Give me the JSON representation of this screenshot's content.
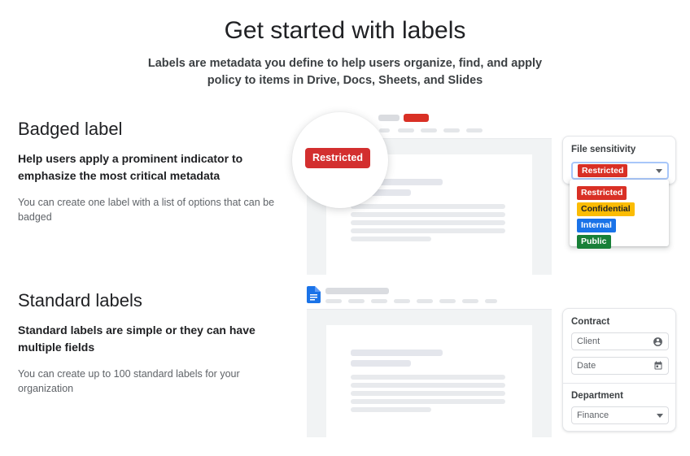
{
  "header": {
    "title": "Get started with labels",
    "subtitle": "Labels are metadata you define to help users organize, find, and apply policy to items in Drive, Docs, Sheets, and Slides"
  },
  "sections": [
    {
      "id": "badged",
      "title": "Badged label",
      "lead": "Help users apply a prominent indicator to emphasize the most critical metadata",
      "body": "You can create one label with a list of options that can be badged"
    },
    {
      "id": "standard",
      "title": "Standard labels",
      "lead": "Standard labels are simple or they can have multiple fields",
      "body": "You can create up to 100 standard labels for your organization"
    }
  ],
  "magnifier": {
    "badge_label": "Restricted",
    "badge_color": "#d32f2f"
  },
  "file_sensitivity_card": {
    "label": "File sensitivity",
    "selected_value": "Restricted",
    "selected_color": "#d93025",
    "caret_icon": "chevron-down-icon",
    "options": [
      {
        "label": "Restricted",
        "color": "#d93025",
        "text_color": "#ffffff"
      },
      {
        "label": "Confidential",
        "color": "#fbbc04",
        "text_color": "#202124"
      },
      {
        "label": "Internal",
        "color": "#1a73e8",
        "text_color": "#ffffff"
      },
      {
        "label": "Public",
        "color": "#188038",
        "text_color": "#ffffff"
      }
    ]
  },
  "contract_card": {
    "label": "Contract",
    "fields": [
      {
        "name": "client",
        "placeholder": "Client",
        "icon": "account-circle-icon"
      },
      {
        "name": "date",
        "placeholder": "Date",
        "icon": "calendar-icon"
      }
    ]
  },
  "department_card": {
    "label": "Department",
    "value": "Finance",
    "caret_icon": "chevron-down-icon"
  },
  "doc_mockups": {
    "docs_icon_color": "#1a73e8",
    "badge_color": "#d93025"
  }
}
